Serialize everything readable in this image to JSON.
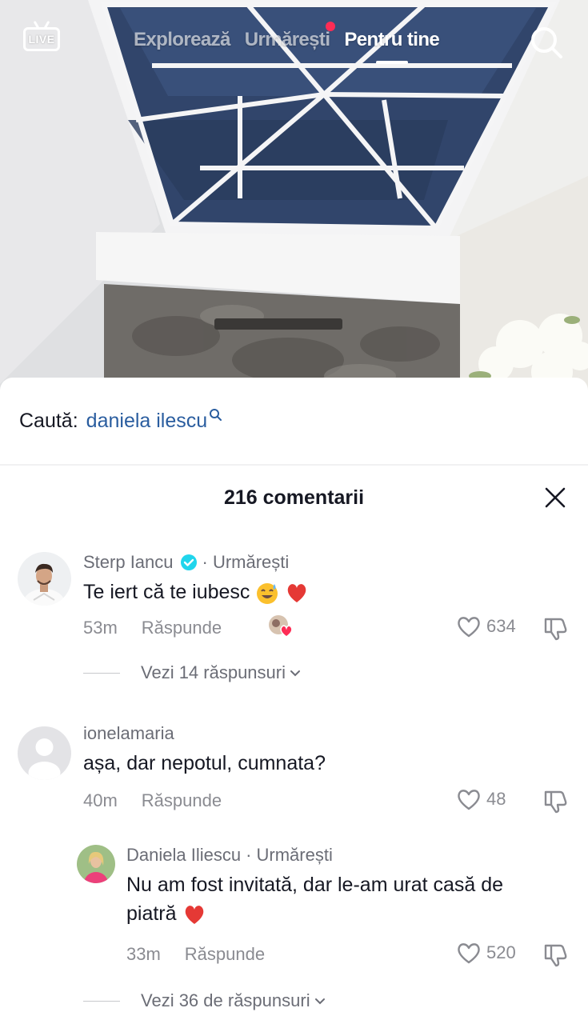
{
  "topnav": {
    "live_label": "LIVE",
    "tabs": [
      {
        "label": "Explorează",
        "active": false,
        "dot": false
      },
      {
        "label": "Urmărești",
        "active": false,
        "dot": true
      },
      {
        "label": "Pentru tine",
        "active": true,
        "dot": false
      }
    ]
  },
  "search_suggestion": {
    "prefix": "Caută:",
    "term": "daniela ilescu"
  },
  "comments_header": {
    "count_label": "216 comentarii"
  },
  "comments": [
    {
      "author": "Sterp Iancu",
      "verified": true,
      "relation": "· Urmărești",
      "text": "Te iert că te iubesc",
      "time": "53m",
      "reply_label": "Răspunde",
      "likes": "634",
      "view_replies": "Vezi 14 răspunsuri"
    },
    {
      "author": "ionelamaria",
      "verified": false,
      "relation": "",
      "text": "așa, dar nepotul, cumnata?",
      "time": "40m",
      "reply_label": "Răspunde",
      "likes": "48"
    }
  ],
  "reply": {
    "author": "Daniela Iliescu",
    "relation": "· Urmărești",
    "text_line1": "Nu am fost invitată, dar le-am urat casă de",
    "text_line2": "piatră",
    "time": "33m",
    "reply_label": "Răspunde",
    "likes": "520",
    "view_replies": "Vezi 36 de răspunsuri"
  },
  "colors": {
    "accent_red": "#fe2c55",
    "link_blue": "#2a5d9f",
    "verified_blue": "#20d5ec",
    "text_primary": "#161823",
    "text_secondary": "#8a8b91"
  }
}
